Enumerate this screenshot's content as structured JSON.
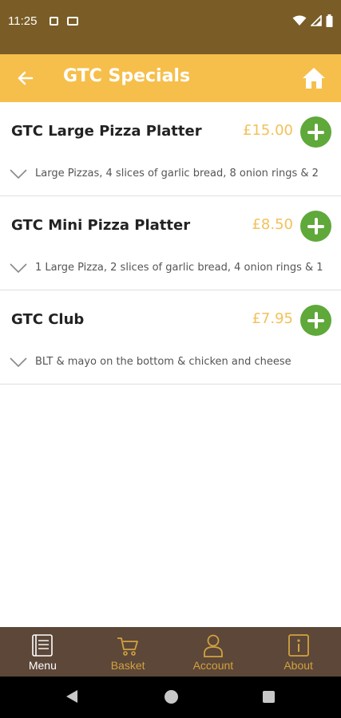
{
  "status_bar": {
    "time": "11:25",
    "icons": [
      "notification-icon",
      "message-icon",
      "wifi-icon",
      "signal-icon",
      "battery-icon"
    ]
  },
  "app_bar": {
    "title": "GTC Specials",
    "back_icon": "arrow-left-icon",
    "home_icon": "home-icon",
    "background": "#f6bf4b"
  },
  "items": [
    {
      "name": "GTC Large Pizza Platter",
      "price": "£15.00",
      "description": "Large Pizzas, 4 slices of garlic bread, 8 onion rings & 2"
    },
    {
      "name": "GTC Mini Pizza Platter",
      "price": "£8.50",
      "description": "1 Large Pizza, 2 slices of garlic bread, 4 onion rings & 1"
    },
    {
      "name": "GTC Club",
      "price": "£7.95",
      "description": "BLT & mayo on the bottom & chicken and cheese"
    }
  ],
  "bottom_nav": {
    "items": [
      {
        "label": "Menu",
        "icon": "menu-book-icon"
      },
      {
        "label": "Basket",
        "icon": "cart-icon"
      },
      {
        "label": "Account",
        "icon": "user-icon"
      },
      {
        "label": "About",
        "icon": "info-icon"
      }
    ],
    "background": "#5c4738",
    "active_color": "#ffffff",
    "inactive_color": "#d2a23f"
  },
  "colors": {
    "price": "#f2c15a",
    "add_button": "#5fa83a",
    "status_bar": "#7a5d26"
  }
}
